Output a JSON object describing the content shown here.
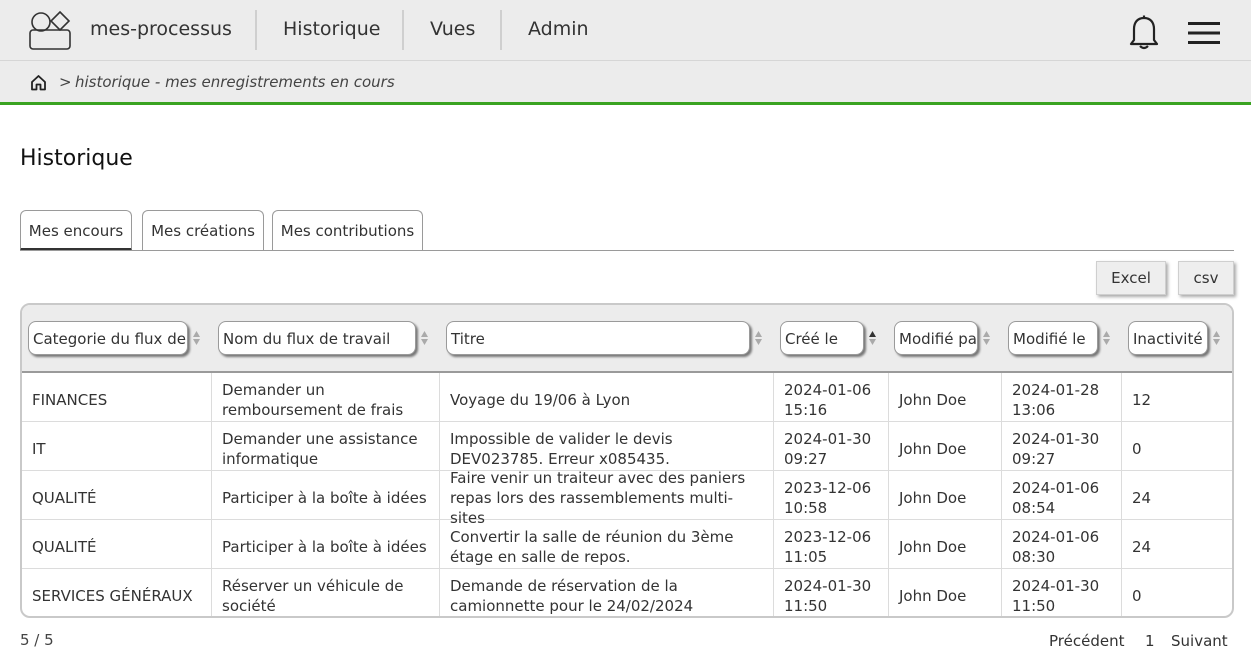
{
  "header": {
    "brand": "mes-processus",
    "nav": [
      "Historique",
      "Vues",
      "Admin"
    ]
  },
  "breadcrumb": {
    "separator": ">",
    "text": "historique - mes enregistrements en cours"
  },
  "page": {
    "title": "Historique"
  },
  "tabs": [
    "Mes encours",
    "Mes créations",
    "Mes contributions"
  ],
  "export": {
    "excel": "Excel",
    "csv": "csv"
  },
  "table": {
    "headers": [
      "Categorie du flux de",
      "Nom du flux de travail",
      "Titre",
      "Créé le",
      "Modifié pa",
      "Modifié le",
      "Inactivité"
    ],
    "rows": [
      {
        "categorie": "FINANCES",
        "flux": "Demander un remboursement de frais",
        "titre": "Voyage du 19/06 à Lyon",
        "cree": "2024-01-06 15:16",
        "modifie_par": "John Doe",
        "modifie_le": "2024-01-28 13:06",
        "inactivite": "12"
      },
      {
        "categorie": "IT",
        "flux": "Demander une assistance informatique",
        "titre": "Impossible de valider le devis DEV023785. Erreur x085435.",
        "cree": "2024-01-30 09:27",
        "modifie_par": "John Doe",
        "modifie_le": "2024-01-30 09:27",
        "inactivite": "0"
      },
      {
        "categorie": "QUALITÉ",
        "flux": "Participer à la boîte à idées",
        "titre": "Faire venir un traiteur avec des paniers repas lors des rassemblements multi-sites",
        "cree": "2023-12-06 10:58",
        "modifie_par": "John Doe",
        "modifie_le": "2024-01-06 08:54",
        "inactivite": "24"
      },
      {
        "categorie": "QUALITÉ",
        "flux": "Participer à la boîte à idées",
        "titre": "Convertir la salle de réunion du 3ème étage en salle de repos.",
        "cree": "2023-12-06 11:05",
        "modifie_par": "John Doe",
        "modifie_le": "2024-01-06 08:30",
        "inactivite": "24"
      },
      {
        "categorie": "SERVICES GÉNÉRAUX",
        "flux": "Réserver un véhicule de société",
        "titre": "Demande de réservation de la camionnette pour le 24/02/2024",
        "cree": "2024-01-30 11:50",
        "modifie_par": "John Doe",
        "modifie_le": "2024-01-30 11:50",
        "inactivite": "0"
      }
    ]
  },
  "footer": {
    "count": "5 / 5",
    "prev": "Précédent",
    "page": "1",
    "next": "Suivant"
  },
  "colors": {
    "accent": "#3aa321",
    "bar": "#ececec",
    "border": "#9a9a9a"
  }
}
